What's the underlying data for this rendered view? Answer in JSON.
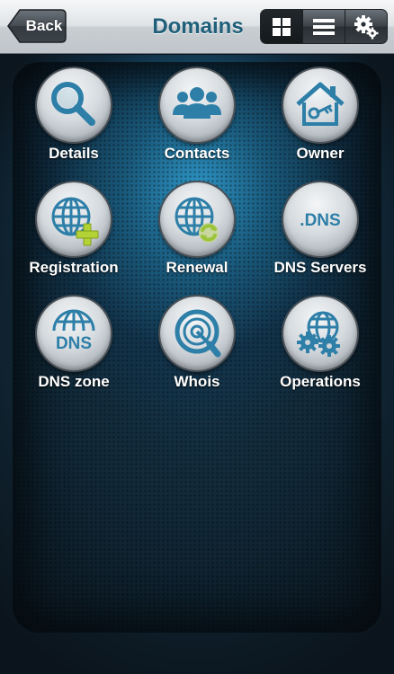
{
  "header": {
    "back_label": "Back",
    "title": "Domains",
    "view_buttons": [
      "grid-view-icon",
      "list-view-icon",
      "settings-gears-icon"
    ]
  },
  "menu": {
    "items": [
      {
        "label": "Details",
        "icon": "magnifier-icon"
      },
      {
        "label": "Contacts",
        "icon": "people-icon"
      },
      {
        "label": "Owner",
        "icon": "house-key-icon"
      },
      {
        "label": "Registration",
        "icon": "globe-plus-icon"
      },
      {
        "label": "Renewal",
        "icon": "globe-refresh-icon"
      },
      {
        "label": "DNS Servers",
        "icon": "dns-text-icon",
        "icon_text": ".DNS"
      },
      {
        "label": "DNS zone",
        "icon": "globe-dns-icon",
        "icon_text": "DNS"
      },
      {
        "label": "Whois",
        "icon": "radar-magnifier-icon"
      },
      {
        "label": "Operations",
        "icon": "globe-gears-icon"
      }
    ]
  },
  "colors": {
    "title": "#1f5f7a",
    "accent_green": "#9bc43a",
    "icon_blue": "#2e7fa8"
  }
}
